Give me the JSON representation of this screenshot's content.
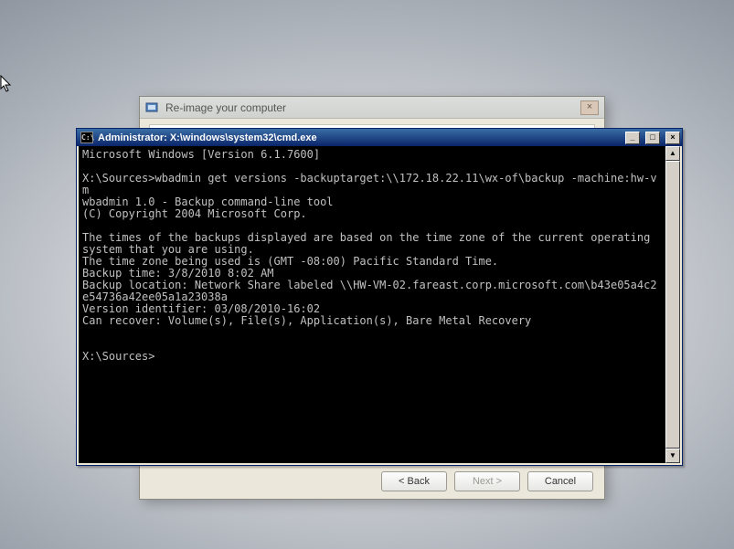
{
  "reimage_dialog": {
    "title": "Re-image your computer",
    "buttons": {
      "back": "< Back",
      "next": "Next >",
      "cancel": "Cancel"
    }
  },
  "cmd_window": {
    "title": "Administrator: X:\\windows\\system32\\cmd.exe",
    "sys_icon_label": "C:\\",
    "min_label": "_",
    "max_label": "□",
    "close_label": "×",
    "scroll_up": "▲",
    "scroll_down": "▼",
    "lines": {
      "l0": "Microsoft Windows [Version 6.1.7600]",
      "l1": "",
      "l2": "X:\\Sources>wbadmin get versions -backuptarget:\\\\172.18.22.11\\wx-of\\backup -machine:hw-vm",
      "l3": "wbadmin 1.0 - Backup command-line tool",
      "l4": "(C) Copyright 2004 Microsoft Corp.",
      "l5": "",
      "l6": "The times of the backups displayed are based on the time zone of the current operating system that you are using.",
      "l7": "The time zone being used is (GMT -08:00) Pacific Standard Time.",
      "l8": "Backup time: 3/8/2010 8:02 AM",
      "l9": "Backup location: Network Share labeled \\\\HW-VM-02.fareast.corp.microsoft.com\\b43e05a4c2e54736a42ee05a1a23038a",
      "l10": "Version identifier: 03/08/2010-16:02",
      "l11": "Can recover: Volume(s), File(s), Application(s), Bare Metal Recovery",
      "l12": "",
      "l13": "",
      "l14": "X:\\Sources>"
    }
  }
}
